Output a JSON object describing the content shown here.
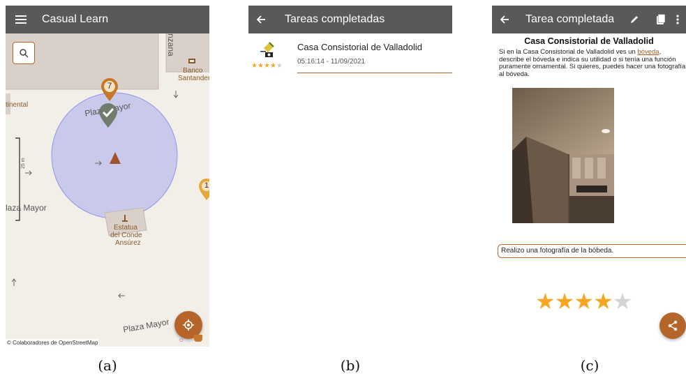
{
  "panel_a": {
    "appbar": {
      "title": "Casual Learn",
      "menu_icon": "menu-icon"
    },
    "map": {
      "labels": {
        "street_top": "nzana",
        "bank_line1": "Banco",
        "bank_line2": "Santander",
        "continental": "tinental",
        "plaza_mayor_top": "Plaza Mayor",
        "plaza_mayor_left": "laza Mayor",
        "plaza_mayor_bottom": "Plaza Mayor",
        "statue_line1": "Estatua",
        "statue_line2": "del Conde",
        "statue_line3": "Ansúrez",
        "scale": "25 m"
      },
      "markers": {
        "pin_number": "7",
        "pin_right_number": "1"
      },
      "attribution": "© Colaboradores de OpenStreetMap"
    },
    "caption": "(a)"
  },
  "panel_b": {
    "appbar": {
      "title": "Tareas completadas",
      "back_icon": "arrow-back-icon"
    },
    "items": [
      {
        "title": "Casa Consistorial de Valladolid",
        "timestamp": "05:16:14 - 11/09/2021",
        "rating": 4,
        "max_rating": 5
      }
    ],
    "caption": "(b)"
  },
  "panel_c": {
    "appbar": {
      "title": "Tarea completada",
      "back_icon": "arrow-back-icon",
      "edit_icon": "pencil-icon",
      "copy_icon": "copy-icon",
      "more_icon": "more-vert-icon"
    },
    "title": "Casa Consistorial de Valladolid",
    "description_pre": "Si en la Casa Consistorial de Valladolid ves un ",
    "description_link": "bóveda",
    "description_post": ", describe el bóveda e indica su utilidad o si tenía una función puramente ornamental. Si quieres, puedes hacer una fotografía al bóveda.",
    "answer": "Realizo una fotografía de la bóbeda.",
    "rating": 4,
    "max_rating": 5,
    "share_icon": "share-icon",
    "caption": "(c)"
  },
  "colors": {
    "appbar": "#595959",
    "accent": "#b5652a",
    "star": "#f5a623",
    "location_circle": "#9fa3f0"
  }
}
